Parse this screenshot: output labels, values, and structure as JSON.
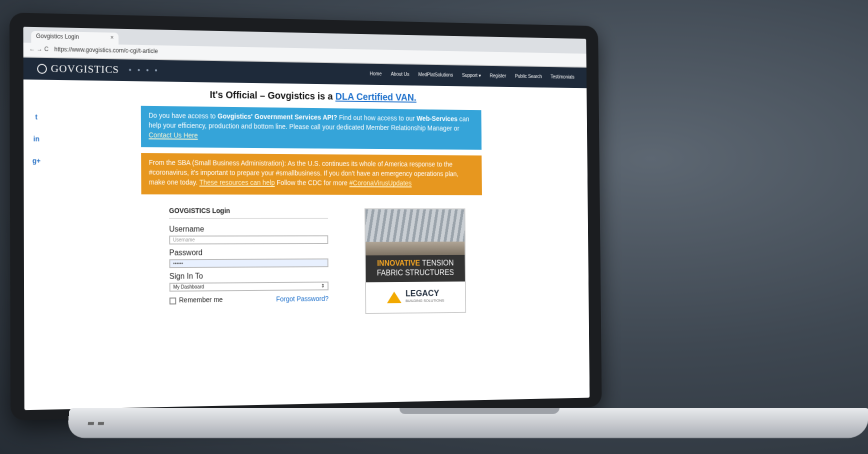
{
  "browser": {
    "tab_title": "Govgistics Login",
    "tab_close": "×",
    "nav_buttons": "← → C",
    "url": "https://www.govgistics.com/c-cgi/t-article"
  },
  "navbar": {
    "logo_text": "GOVGISTICS",
    "menu": [
      "Home",
      "About Us",
      "MedPlatSolutions",
      "Support ▾",
      "Register",
      "Public Search",
      "Testimonials"
    ]
  },
  "headline": {
    "text": "It's Official – Govgistics is a ",
    "link": "DLA Certified VAN."
  },
  "share": [
    "t",
    "in",
    "g+"
  ],
  "notice_api": {
    "intro": "Do you have access to ",
    "bold1": "Govgistics' Government Services API?",
    "mid": " Find out how access to our ",
    "bold2": "Web-Services",
    "rest": " can help your efficiency, production and bottom line. Please call your dedicated Member Relationship Manager or ",
    "link": "Contact Us Here"
  },
  "notice_sba": {
    "text": "From the SBA (Small Business Administration): As the U.S. continues its whole of America response to the #coronavirus, it's important to prepare your #smallbusiness. If you don't have an emergency operations plan, make one today. ",
    "link1": "These resources can help",
    "link2": " Follow the CDC for more ",
    "link3": "#CoronaVirusUpdates"
  },
  "login": {
    "title": "GOVGISTICS Login",
    "username_label": "Username",
    "username_placeholder": "Username",
    "password_label": "Password",
    "password_value": "••••••",
    "signin_label": "Sign In To",
    "signin_value": "My Dashboard",
    "signin_arrow": "⇕",
    "remember_label": "Remember me",
    "forgot_label": "Forgot Password?"
  },
  "ad": {
    "highlight": "INNOVATIVE",
    "line1_rest": " TENSION",
    "line2": "FABRIC STRUCTURES",
    "brand": "LEGACY",
    "brand_sub": "BUILDING SOLUTIONS"
  }
}
